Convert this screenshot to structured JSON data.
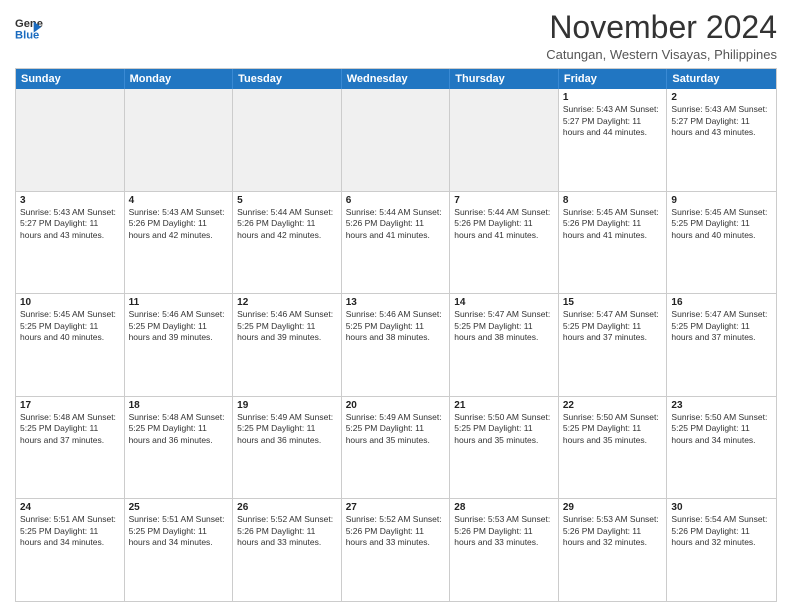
{
  "header": {
    "logo": {
      "general": "General",
      "blue": "Blue"
    },
    "month": "November 2024",
    "location": "Catungan, Western Visayas, Philippines"
  },
  "weekdays": [
    "Sunday",
    "Monday",
    "Tuesday",
    "Wednesday",
    "Thursday",
    "Friday",
    "Saturday"
  ],
  "rows": [
    [
      {
        "day": "",
        "info": ""
      },
      {
        "day": "",
        "info": ""
      },
      {
        "day": "",
        "info": ""
      },
      {
        "day": "",
        "info": ""
      },
      {
        "day": "",
        "info": ""
      },
      {
        "day": "1",
        "info": "Sunrise: 5:43 AM\nSunset: 5:27 PM\nDaylight: 11 hours and 44 minutes."
      },
      {
        "day": "2",
        "info": "Sunrise: 5:43 AM\nSunset: 5:27 PM\nDaylight: 11 hours and 43 minutes."
      }
    ],
    [
      {
        "day": "3",
        "info": "Sunrise: 5:43 AM\nSunset: 5:27 PM\nDaylight: 11 hours and 43 minutes."
      },
      {
        "day": "4",
        "info": "Sunrise: 5:43 AM\nSunset: 5:26 PM\nDaylight: 11 hours and 42 minutes."
      },
      {
        "day": "5",
        "info": "Sunrise: 5:44 AM\nSunset: 5:26 PM\nDaylight: 11 hours and 42 minutes."
      },
      {
        "day": "6",
        "info": "Sunrise: 5:44 AM\nSunset: 5:26 PM\nDaylight: 11 hours and 41 minutes."
      },
      {
        "day": "7",
        "info": "Sunrise: 5:44 AM\nSunset: 5:26 PM\nDaylight: 11 hours and 41 minutes."
      },
      {
        "day": "8",
        "info": "Sunrise: 5:45 AM\nSunset: 5:26 PM\nDaylight: 11 hours and 41 minutes."
      },
      {
        "day": "9",
        "info": "Sunrise: 5:45 AM\nSunset: 5:25 PM\nDaylight: 11 hours and 40 minutes."
      }
    ],
    [
      {
        "day": "10",
        "info": "Sunrise: 5:45 AM\nSunset: 5:25 PM\nDaylight: 11 hours and 40 minutes."
      },
      {
        "day": "11",
        "info": "Sunrise: 5:46 AM\nSunset: 5:25 PM\nDaylight: 11 hours and 39 minutes."
      },
      {
        "day": "12",
        "info": "Sunrise: 5:46 AM\nSunset: 5:25 PM\nDaylight: 11 hours and 39 minutes."
      },
      {
        "day": "13",
        "info": "Sunrise: 5:46 AM\nSunset: 5:25 PM\nDaylight: 11 hours and 38 minutes."
      },
      {
        "day": "14",
        "info": "Sunrise: 5:47 AM\nSunset: 5:25 PM\nDaylight: 11 hours and 38 minutes."
      },
      {
        "day": "15",
        "info": "Sunrise: 5:47 AM\nSunset: 5:25 PM\nDaylight: 11 hours and 37 minutes."
      },
      {
        "day": "16",
        "info": "Sunrise: 5:47 AM\nSunset: 5:25 PM\nDaylight: 11 hours and 37 minutes."
      }
    ],
    [
      {
        "day": "17",
        "info": "Sunrise: 5:48 AM\nSunset: 5:25 PM\nDaylight: 11 hours and 37 minutes."
      },
      {
        "day": "18",
        "info": "Sunrise: 5:48 AM\nSunset: 5:25 PM\nDaylight: 11 hours and 36 minutes."
      },
      {
        "day": "19",
        "info": "Sunrise: 5:49 AM\nSunset: 5:25 PM\nDaylight: 11 hours and 36 minutes."
      },
      {
        "day": "20",
        "info": "Sunrise: 5:49 AM\nSunset: 5:25 PM\nDaylight: 11 hours and 35 minutes."
      },
      {
        "day": "21",
        "info": "Sunrise: 5:50 AM\nSunset: 5:25 PM\nDaylight: 11 hours and 35 minutes."
      },
      {
        "day": "22",
        "info": "Sunrise: 5:50 AM\nSunset: 5:25 PM\nDaylight: 11 hours and 35 minutes."
      },
      {
        "day": "23",
        "info": "Sunrise: 5:50 AM\nSunset: 5:25 PM\nDaylight: 11 hours and 34 minutes."
      }
    ],
    [
      {
        "day": "24",
        "info": "Sunrise: 5:51 AM\nSunset: 5:25 PM\nDaylight: 11 hours and 34 minutes."
      },
      {
        "day": "25",
        "info": "Sunrise: 5:51 AM\nSunset: 5:25 PM\nDaylight: 11 hours and 34 minutes."
      },
      {
        "day": "26",
        "info": "Sunrise: 5:52 AM\nSunset: 5:26 PM\nDaylight: 11 hours and 33 minutes."
      },
      {
        "day": "27",
        "info": "Sunrise: 5:52 AM\nSunset: 5:26 PM\nDaylight: 11 hours and 33 minutes."
      },
      {
        "day": "28",
        "info": "Sunrise: 5:53 AM\nSunset: 5:26 PM\nDaylight: 11 hours and 33 minutes."
      },
      {
        "day": "29",
        "info": "Sunrise: 5:53 AM\nSunset: 5:26 PM\nDaylight: 11 hours and 32 minutes."
      },
      {
        "day": "30",
        "info": "Sunrise: 5:54 AM\nSunset: 5:26 PM\nDaylight: 11 hours and 32 minutes."
      }
    ]
  ]
}
